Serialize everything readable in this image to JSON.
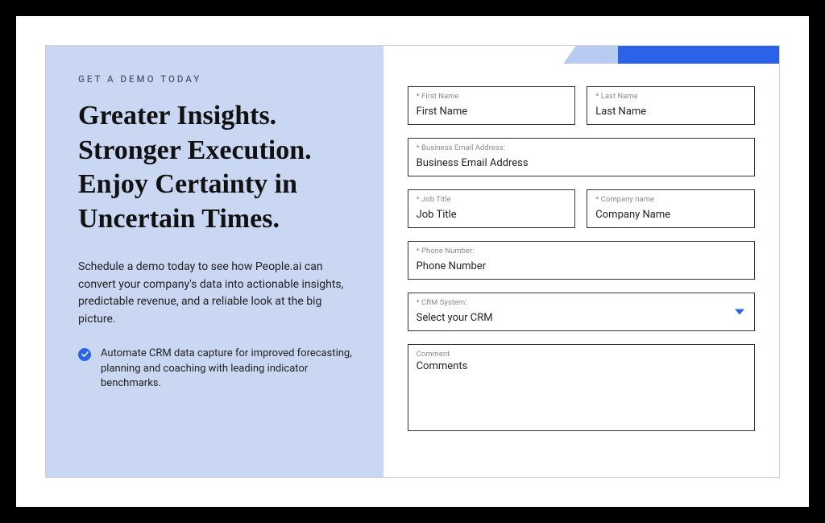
{
  "eyebrow": "GET A DEMO TODAY",
  "headline": "Greater Insights. Stronger Execution. Enjoy Certainty in Uncertain Times.",
  "subcopy": "Schedule a demo today to see how People.ai can convert your company's data into actionable insights, predictable revenue, and a reliable look at the big picture.",
  "bullet": "Automate CRM data capture for improved forecasting, planning and coaching with leading indicator benchmarks.",
  "form": {
    "first_name": {
      "label": "* First Name",
      "placeholder": "First Name"
    },
    "last_name": {
      "label": "* Last Name",
      "placeholder": "Last Name"
    },
    "email": {
      "label": "* Business Email Address:",
      "placeholder": "Business Email Address"
    },
    "job_title": {
      "label": "* Job Title",
      "placeholder": "Job Title"
    },
    "company": {
      "label": "* Company name",
      "placeholder": "Company Name"
    },
    "phone": {
      "label": "* Phone Number:",
      "placeholder": "Phone Number"
    },
    "crm": {
      "label": "* CRM System:",
      "placeholder": "Select your CRM"
    },
    "comment": {
      "label": "Comment",
      "placeholder": "Comments"
    }
  }
}
